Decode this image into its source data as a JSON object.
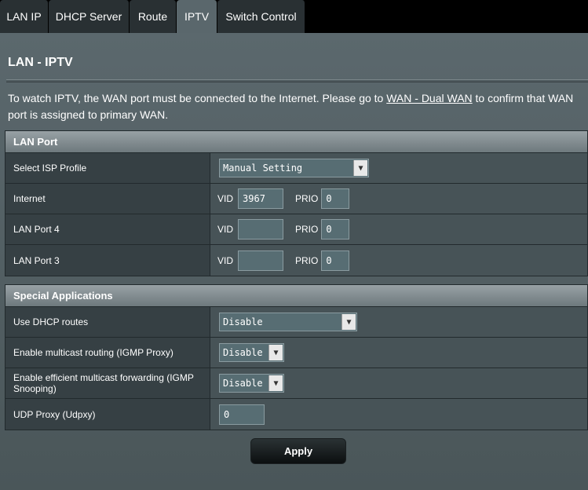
{
  "tabs": [
    {
      "label": "LAN IP"
    },
    {
      "label": "DHCP Server"
    },
    {
      "label": "Route"
    },
    {
      "label": "IPTV"
    },
    {
      "label": "Switch Control"
    }
  ],
  "page": {
    "title": "LAN - IPTV",
    "desc_before": "To watch IPTV, the WAN port must be connected to the Internet. Please go to ",
    "desc_link": "WAN - Dual WAN",
    "desc_after": " to confirm that WAN port is assigned to primary WAN."
  },
  "lan_port": {
    "header": "LAN Port",
    "isp_label": "Select ISP Profile",
    "isp_value": "Manual Setting",
    "vid_label": "VID",
    "prio_label": "PRIO",
    "rows": [
      {
        "label": "Internet",
        "vid": "3967",
        "prio": "0"
      },
      {
        "label": "LAN Port 4",
        "vid": "",
        "prio": "0"
      },
      {
        "label": "LAN Port 3",
        "vid": "",
        "prio": "0"
      }
    ]
  },
  "special": {
    "header": "Special Applications",
    "dhcp_label": "Use DHCP routes",
    "dhcp_value": "Disable",
    "igmp_proxy_label": "Enable multicast routing (IGMP Proxy)",
    "igmp_proxy_value": "Disable",
    "igmp_snoop_label": "Enable efficient multicast forwarding (IGMP Snooping)",
    "igmp_snoop_value": "Disable",
    "udpxy_label": "UDP Proxy (Udpxy)",
    "udpxy_value": "0"
  },
  "apply_label": "Apply",
  "colors": {
    "active_tab": "#5a676c",
    "tab": "#293033",
    "background": "#4d595d"
  }
}
